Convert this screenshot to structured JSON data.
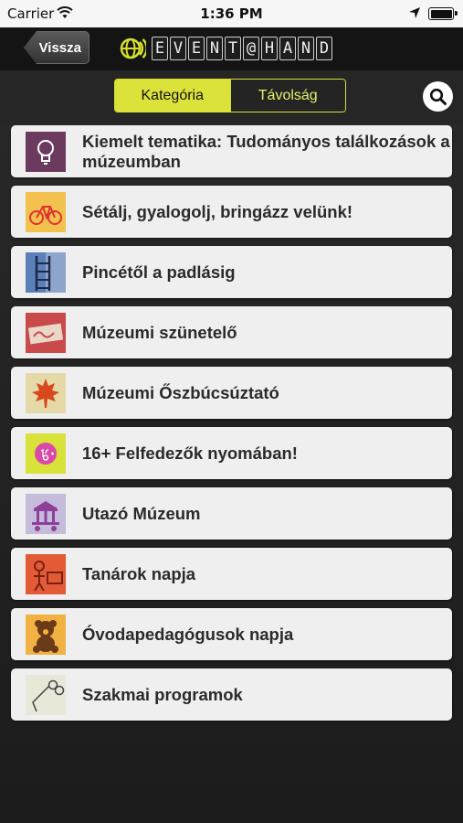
{
  "status_bar": {
    "carrier": "Carrier",
    "time": "1:36 PM"
  },
  "nav": {
    "back_label": "Vissza",
    "logo_letters": [
      "E",
      "V",
      "E",
      "N",
      "T",
      "@",
      "H",
      "A",
      "N",
      "D"
    ]
  },
  "segments": {
    "active": "Kategória",
    "inactive": "Távolság",
    "active_color": "#dbe33a"
  },
  "items": [
    {
      "label": "Kiemelt tematika: Tudományos találkozások a múzeumban",
      "icon": "lightbulb-icon"
    },
    {
      "label": "Sétálj, gyalogolj, bringázz velünk!",
      "icon": "bicycle-icon"
    },
    {
      "label": "Pincétől a padlásig",
      "icon": "ladder-icon"
    },
    {
      "label": "Múzeumi szünetelő",
      "icon": "sign-icon"
    },
    {
      "label": "Múzeumi Őszbúcsúztató",
      "icon": "maple-leaf-icon"
    },
    {
      "label": "16+ Felfedezők nyomában!",
      "icon": "sixteen-plus-icon"
    },
    {
      "label": "Utazó Múzeum",
      "icon": "museum-wagon-icon"
    },
    {
      "label": "Tanárok napja",
      "icon": "teacher-icon"
    },
    {
      "label": "Óvodapedagógusok napja",
      "icon": "teddy-bear-icon"
    },
    {
      "label": "Szakmai programok",
      "icon": "glasses-icon"
    }
  ]
}
